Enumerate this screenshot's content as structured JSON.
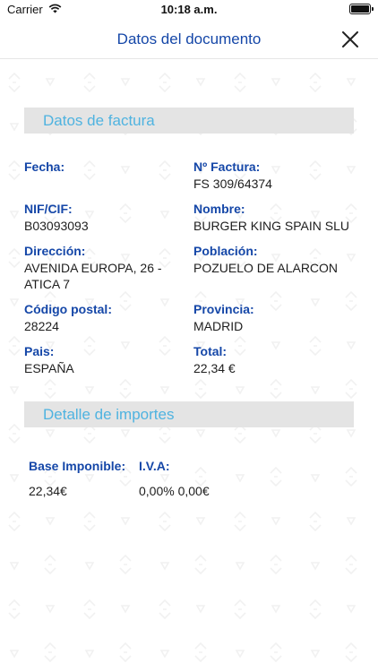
{
  "status_bar": {
    "carrier": "Carrier",
    "time": "10:18 a.m."
  },
  "nav": {
    "title": "Datos del documento"
  },
  "factura": {
    "header": "Datos de factura",
    "fields": {
      "fecha": {
        "label": "Fecha:",
        "value": ""
      },
      "numero": {
        "label": "Nº Factura:",
        "value": "FS 309/64374"
      },
      "nif": {
        "label": "NIF/CIF:",
        "value": "B03093093"
      },
      "nombre": {
        "label": "Nombre:",
        "value": "BURGER KING SPAIN SLU"
      },
      "direccion": {
        "label": "Dirección:",
        "value_line1": "AVENIDA EUROPA, 26 -",
        "value_line2": "ATICA 7"
      },
      "poblacion": {
        "label": "Población:",
        "value": "POZUELO DE ALARCON"
      },
      "cp": {
        "label": "Código postal:",
        "value": "28224"
      },
      "provincia": {
        "label": "Provincia:",
        "value": "MADRID"
      },
      "pais": {
        "label": "Pais:",
        "value": "ESPAÑA"
      },
      "total": {
        "label": "Total:",
        "value": "22,34 €"
      }
    }
  },
  "importes": {
    "header": "Detalle de importes",
    "base_label": "Base Imponible:",
    "iva_label": "I.V.A:",
    "base_value": "22,34€",
    "iva_value": "0,00% 0,00€"
  },
  "icons": {
    "wifi": "wifi-icon",
    "battery": "battery-icon",
    "close": "close-icon"
  }
}
